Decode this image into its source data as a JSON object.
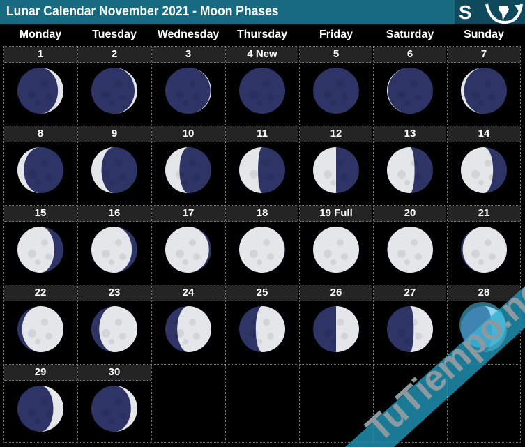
{
  "header": {
    "title": "Lunar Calendar November 2021 - Moon Phases",
    "hemisphere_label": "S",
    "hemisphere_icon": "south-america-globe-icon",
    "bar_color": "#176a80",
    "hemi_color": "#0f4a5c"
  },
  "weekdays": [
    "Monday",
    "Tuesday",
    "Wednesday",
    "Thursday",
    "Friday",
    "Saturday",
    "Sunday"
  ],
  "start_weekday_index": 0,
  "days": [
    {
      "label": "1",
      "illum": 0.12,
      "phase": "waning"
    },
    {
      "label": "2",
      "illum": 0.06,
      "phase": "waning"
    },
    {
      "label": "3",
      "illum": 0.02,
      "phase": "waning"
    },
    {
      "label": "4 New",
      "illum": 0.0,
      "phase": "new"
    },
    {
      "label": "5",
      "illum": 0.0,
      "phase": "waxing"
    },
    {
      "label": "6",
      "illum": 0.02,
      "phase": "waxing"
    },
    {
      "label": "7",
      "illum": 0.07,
      "phase": "waxing"
    },
    {
      "label": "8",
      "illum": 0.14,
      "phase": "waxing"
    },
    {
      "label": "9",
      "illum": 0.22,
      "phase": "waxing"
    },
    {
      "label": "10",
      "illum": 0.31,
      "phase": "waxing"
    },
    {
      "label": "11",
      "illum": 0.41,
      "phase": "waxing"
    },
    {
      "label": "12",
      "illum": 0.5,
      "phase": "waxing"
    },
    {
      "label": "13",
      "illum": 0.6,
      "phase": "waxing"
    },
    {
      "label": "14",
      "illum": 0.7,
      "phase": "waxing"
    },
    {
      "label": "15",
      "illum": 0.8,
      "phase": "waxing"
    },
    {
      "label": "16",
      "illum": 0.88,
      "phase": "waxing"
    },
    {
      "label": "17",
      "illum": 0.95,
      "phase": "waxing"
    },
    {
      "label": "18",
      "illum": 0.99,
      "phase": "waxing"
    },
    {
      "label": "19 Full",
      "illum": 1.0,
      "phase": "full"
    },
    {
      "label": "20",
      "illum": 0.99,
      "phase": "waning"
    },
    {
      "label": "21",
      "illum": 0.96,
      "phase": "waning"
    },
    {
      "label": "22",
      "illum": 0.9,
      "phase": "waning"
    },
    {
      "label": "23",
      "illum": 0.83,
      "phase": "waning"
    },
    {
      "label": "24",
      "illum": 0.74,
      "phase": "waning"
    },
    {
      "label": "25",
      "illum": 0.64,
      "phase": "waning"
    },
    {
      "label": "26",
      "illum": 0.5,
      "phase": "waning"
    },
    {
      "label": "27",
      "illum": 0.42,
      "phase": "waning"
    },
    {
      "label": "28",
      "illum": 0.32,
      "phase": "waning"
    },
    {
      "label": "29",
      "illum": 0.22,
      "phase": "waning"
    },
    {
      "label": "30",
      "illum": 0.14,
      "phase": "waning"
    }
  ],
  "colors": {
    "moon_dark": "#2e3466",
    "moon_light": "#e4e6ea",
    "day_head_bg": "#242424",
    "grid_line": "#777777"
  },
  "watermark": {
    "text": "TuTiempo.net",
    "color": "#1e8fb0"
  }
}
